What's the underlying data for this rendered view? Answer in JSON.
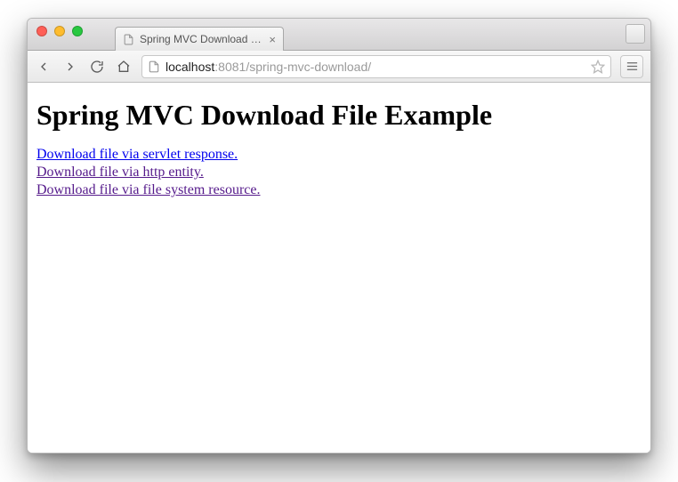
{
  "tab": {
    "title": "Spring MVC Download File"
  },
  "url": {
    "host": "localhost",
    "port": ":8081",
    "path": "/spring-mvc-download/"
  },
  "page": {
    "heading": "Spring MVC Download File Example",
    "links": [
      "Download file via servlet response.",
      "Download file via http entity.",
      "Download file via file system resource."
    ]
  }
}
